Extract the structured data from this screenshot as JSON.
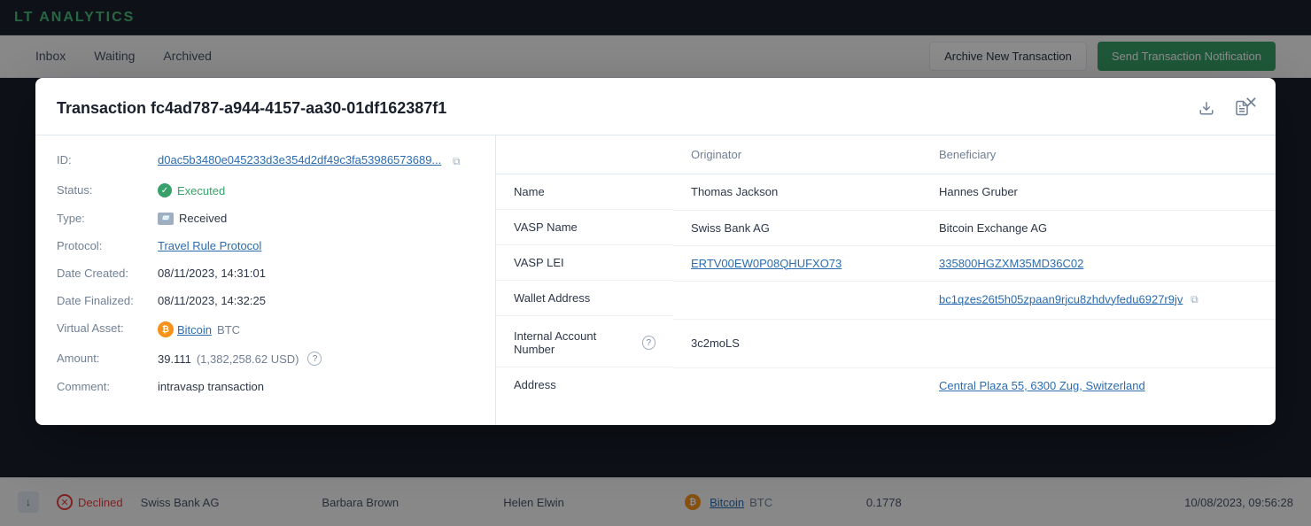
{
  "app": {
    "logo": "LT ANALYTICS"
  },
  "nav": {
    "tabs": [
      {
        "id": "inbox",
        "label": "Inbox"
      },
      {
        "id": "waiting",
        "label": "Waiting"
      },
      {
        "id": "archived",
        "label": "Archived"
      }
    ],
    "archive_btn": "Archive New Transaction",
    "send_btn": "Send Transaction Notification"
  },
  "modal": {
    "title": "Transaction fc4ad787-a944-4157-aa30-01df162387f1",
    "id_label": "ID:",
    "id_value": "d0ac5b3480e045233d3e354d2df49c3fa53986573689...",
    "status_label": "Status:",
    "status_value": "Executed",
    "type_label": "Type:",
    "type_value": "Received",
    "protocol_label": "Protocol:",
    "protocol_value": "Travel Rule Protocol",
    "date_created_label": "Date Created:",
    "date_created_value": "08/11/2023, 14:31:01",
    "date_finalized_label": "Date Finalized:",
    "date_finalized_value": "08/11/2023, 14:32:25",
    "virtual_asset_label": "Virtual Asset:",
    "virtual_asset_value": "Bitcoin",
    "virtual_asset_ticker": "BTC",
    "amount_label": "Amount:",
    "amount_value": "39.111",
    "amount_usd": "(1,382,258.62 USD)",
    "comment_label": "Comment:",
    "comment_value": "intravasp transaction",
    "table": {
      "col_field": "",
      "col_originator": "Originator",
      "col_beneficiary": "Beneficiary",
      "rows": [
        {
          "field": "Name",
          "originator": "Thomas Jackson",
          "beneficiary": "Hannes Gruber"
        },
        {
          "field": "VASP Name",
          "originator": "Swiss Bank AG",
          "beneficiary": "Bitcoin Exchange AG"
        },
        {
          "field": "VASP LEI",
          "originator": "ERTV00EW0P08QHUFXO73",
          "beneficiary": "335800HGZXM35MD36C02"
        },
        {
          "field": "Wallet Address",
          "originator": "",
          "beneficiary": "bc1qzes26t5h05zpaan9rjcu8zhdvyfedu6927r9jv"
        },
        {
          "field": "Internal Account Number",
          "originator": "3c2moLS",
          "beneficiary": ""
        },
        {
          "field": "Address",
          "originator": "",
          "beneficiary": "Central Plaza 55, 6300 Zug, Switzerland"
        }
      ]
    }
  },
  "bg_row": {
    "status": "Declined",
    "vasp": "Swiss Bank AG",
    "originator": "Barbara Brown",
    "beneficiary": "Helen Elwin",
    "asset": "Bitcoin",
    "ticker": "BTC",
    "amount": "0.1778",
    "date": "10/08/2023, 09:56:28"
  }
}
